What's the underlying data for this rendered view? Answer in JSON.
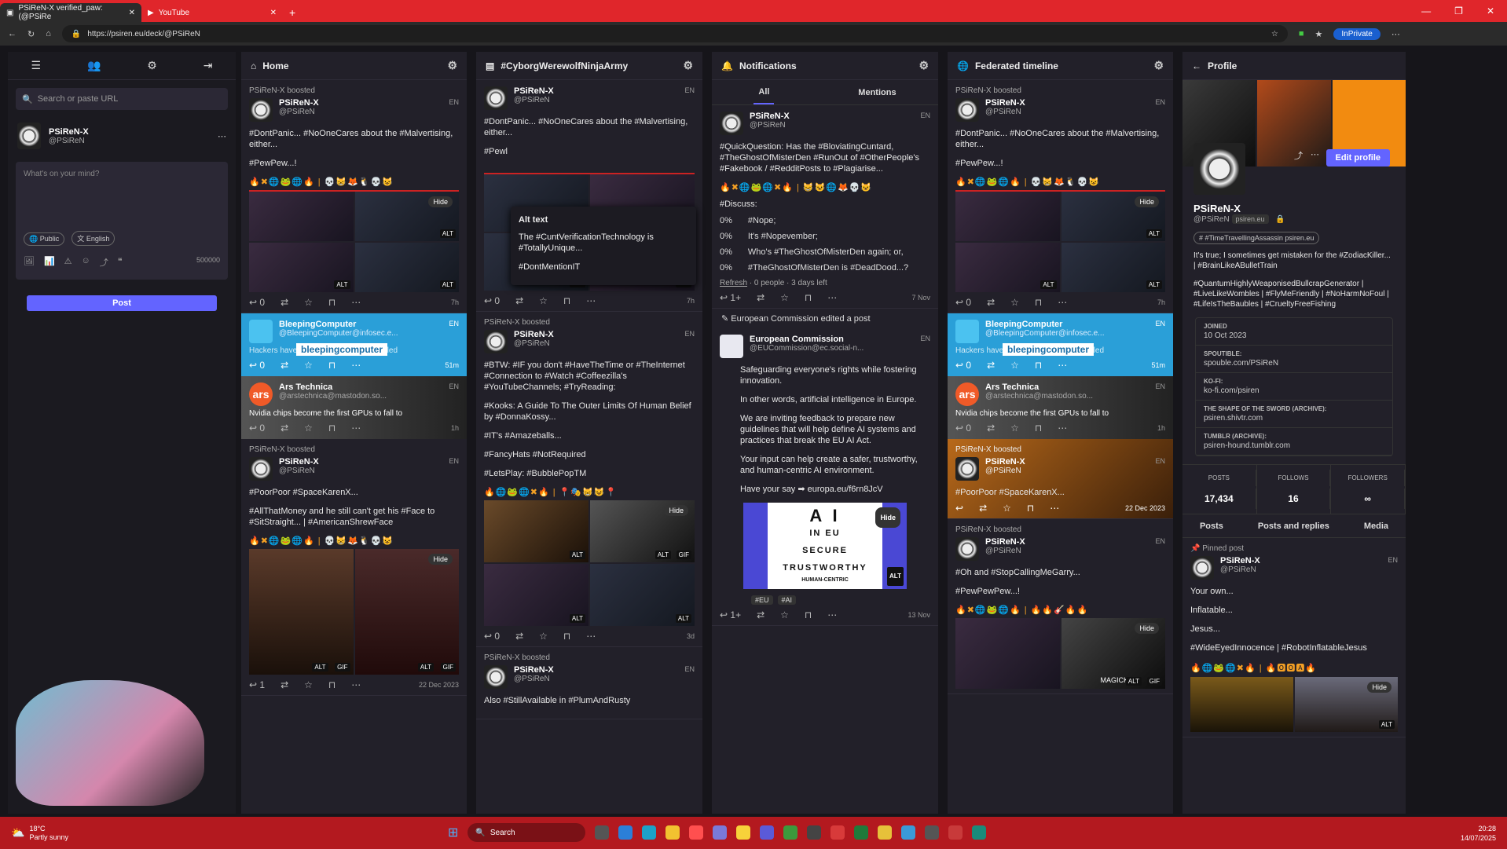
{
  "browser": {
    "tab1": "PSiReN-X verified_paw: (@PSiRe",
    "tab2": "YouTube",
    "url": "https://psiren.eu/deck/@PSiReN",
    "inprivate": "InPrivate"
  },
  "sidebar": {
    "search_placeholder": "Search or paste URL",
    "user_name": "PSiReN-X",
    "user_handle": "@PSiReN",
    "compose_placeholder": "What's on your mind?",
    "visibility": "Public",
    "language": "English",
    "char_count": "500000",
    "post_label": "Post"
  },
  "home": {
    "title": "Home",
    "p1": {
      "boost": "PSiReN-X boosted",
      "name": "PSiReN-X",
      "handle": "@PSiReN",
      "meta": "EN",
      "line1": "#DontPanic... #NoOneCares about the #Malvertising, either...",
      "line2": "#PewPew...!",
      "emoji": "🔥✖🌐🐸🌐🔥 | 💀😸🦊🐧💀😺",
      "time": "7h",
      "hide": "Hide",
      "alt": "ALT"
    },
    "card1": {
      "name": "BleepingComputer",
      "handle": "@BleepingComputer@infosec.e...",
      "text": "Hackers have been exploiting a flaw called",
      "logo": "bleepingcomputer",
      "time": "51m",
      "meta": "EN"
    },
    "card2": {
      "name": "Ars Technica",
      "handle": "@arstechnica@mastodon.so...",
      "text": "Nvidia chips become the first GPUs to fall to",
      "time": "1h",
      "meta": "EN",
      "logo": "ars"
    },
    "p2": {
      "boost": "PSiReN-X boosted",
      "name": "PSiReN-X",
      "handle": "@PSiReN",
      "meta": "EN",
      "line1": "#PoorPoor #SpaceKarenX...",
      "line2": "#AllThatMoney and he still can't get his #Face to #SitStraight... | #AmericanShrewFace",
      "emoji": "🔥✖🌐🐸🌐🔥 | 💀😸🦊🐧💀😺",
      "hide": "Hide",
      "time": "22 Dec 2023",
      "replies": "1",
      "alt": "ALT",
      "gif": "GIF"
    }
  },
  "cyber": {
    "title": "#CyborgWerewolfNinjaArmy",
    "p1": {
      "name": "PSiReN-X",
      "handle": "@PSiReN",
      "meta": "EN",
      "line1": "#DontPanic... #NoOneCares about the #Malvertising, either...",
      "line2": "#Pewl",
      "time": "7h",
      "alt": "ALT"
    },
    "alttip": {
      "title": "Alt text",
      "line1": "The #CuntVerificationTechnology is #TotallyUnique...",
      "line2": "#DontMentionIT"
    },
    "p2": {
      "boost": "PSiReN-X boosted",
      "name": "PSiReN-X",
      "handle": "@PSiReN",
      "meta": "EN",
      "t1": "#BTW: #IF you don't #HaveTheTime or #TheInternet #Connection to #Watch #Coffeezilla's #YouTubeChannels; #TryReading:",
      "t2": "#Kooks: A Guide To The Outer Limits Of Human Belief by #DonnaKossy...",
      "t3": "#IT's #Amazeballs...",
      "t4": "#FancyHats #NotRequired",
      "t5": "#LetsPlay: #BubblePopTM",
      "emoji": "🔥🌐🐸🌐✖🔥 | 📍🎭😸😺📍",
      "hide": "Hide",
      "time": "3d",
      "alt": "ALT",
      "gif": "GIF"
    },
    "p3": {
      "boost": "PSiReN-X boosted",
      "name": "PSiReN-X",
      "handle": "@PSiReN",
      "meta": "EN",
      "t1": "Also #StillAvailable in #PlumAndRusty"
    }
  },
  "notif": {
    "title": "Notifications",
    "tab_all": "All",
    "tab_mentions": "Mentions",
    "p1": {
      "name": "PSiReN-X",
      "handle": "@PSiReN",
      "meta": "EN",
      "t1": "#QuickQuestion: Has the #BloviatingCuntard, #TheGhostOfMisterDen #RunOut of #OtherPeople's #Fakebook / #RedditPosts to #Plagiarise...",
      "emoji": "🔥✖🌐🐸🌐✖🔥 | 😸😺🌐🦊💀😺",
      "discuss": "#Discuss:",
      "o1p": "0%",
      "o1": "#Nope;",
      "o2p": "0%",
      "o2": "It's #Nopevember;",
      "o3p": "0%",
      "o3": "Who's #TheGhostOfMisterDen again; or,",
      "o4p": "0%",
      "o4": "#TheGhostOfMisterDen is #DeadDood...?",
      "refresh": "Refresh",
      "pollinfo": "· 0 people · 3 days left",
      "time": "7 Nov",
      "replies": "1+"
    },
    "edited": "European Commission edited a post",
    "p2": {
      "name": "European Commission",
      "handle": "@EUCommission@ec.social-n...",
      "meta": "EN",
      "t1": "Safeguarding everyone's rights while fostering innovation.",
      "t2": "In other words, artificial intelligence in Europe.",
      "t3": "We are inviting feedback to prepare new guidelines that will help define AI systems and practices that break the EU AI Act.",
      "t4": "Your input can help create a safer, trustworthy, and human-centric AI environment.",
      "t5": "Have your say ➡ europa.eu/f6rn8JcV",
      "img1": "A I",
      "img2": "IN EU",
      "img3": "SECURE",
      "img4": "TRUSTWORTHY",
      "img5": "HUMAN-CENTRIC",
      "hide": "Hide",
      "alt": "ALT",
      "tag1": "#EU",
      "tag2": "#AI",
      "time": "13 Nov",
      "replies": "1+"
    }
  },
  "fed": {
    "title": "Federated timeline",
    "p1": {
      "boost": "PSiReN-X boosted",
      "name": "PSiReN-X",
      "handle": "@PSiReN",
      "meta": "EN",
      "line1": "#DontPanic... #NoOneCares about the #Malvertising, either...",
      "line2": "#PewPew...!",
      "emoji": "🔥✖🌐🐸🌐🔥 | 💀😸🦊🐧💀😺",
      "time": "7h",
      "hide": "Hide",
      "alt": "ALT"
    },
    "card1": {
      "name": "BleepingComputer",
      "handle": "@BleepingComputer@infosec.e...",
      "text": "Hackers have been exploiting a flaw called",
      "logo": "bleepingcomputer",
      "time": "51m",
      "meta": "EN"
    },
    "card2": {
      "name": "Ars Technica",
      "handle": "@arstechnica@mastodon.so...",
      "text": "Nvidia chips become the first GPUs to fall to",
      "time": "1h",
      "meta": "EN",
      "logo": "ars"
    },
    "p2": {
      "boost": "PSiReN-X boosted",
      "name": "PSiReN-X",
      "handle": "@PSiReN",
      "meta": "EN",
      "line1": "#PoorPoor #SpaceKarenX...",
      "time": "22 Dec 2023"
    },
    "p3": {
      "boost": "PSiReN-X boosted",
      "name": "PSiReN-X",
      "handle": "@PSiReN",
      "meta": "EN",
      "t1": "#Oh and #StopCallingMeGarry...",
      "t2": "#PewPewPew...!",
      "emoji": "🔥✖🌐🐸🌐🔥 | 🔥🔥🎸🔥🔥",
      "hide": "Hide",
      "alt": "ALT",
      "gif": "GIF",
      "caption": "MAGICK...?"
    }
  },
  "profile": {
    "title": "Profile",
    "edit": "Edit profile",
    "name": "PSiReN-X",
    "handle": "@PSiReN",
    "domain": "psiren.eu",
    "featured_tag": "#TimeTravellingAssassin",
    "featured_domain": "psiren.eu",
    "bio1": "It's true; I sometimes get mistaken for the #ZodiacKiller... | #BrainLikeABulletTrain",
    "bio2": "#QuantumHighlyWeaponisedBullcrapGenerator | #LiveLikeWombles | #FlyMeFriendly | #NoHarmNoFoul | #LifeIsTheBaubles | #CrueltyFreeFishing",
    "joined_k": "JOINED",
    "joined_v": "10 Oct 2023",
    "f1k": "SPOUTIBLE:",
    "f1v": "spouble.com/PSiReN",
    "f2k": "KO-FI:",
    "f2v": "ko-fi.com/psiren",
    "f3k": "THE SHAPE OF THE SWORD (ARCHIVE):",
    "f3v": "psiren.shivtr.com",
    "f4k": "TUMBLR (ARCHIVE):",
    "f4v": "psiren-hound.tumblr.com",
    "posts_k": "POSTS",
    "posts_v": "17,434",
    "follows_k": "FOLLOWS",
    "follows_v": "16",
    "followers_k": "FOLLOWERS",
    "followers_v": "∞",
    "tab1": "Posts",
    "tab2": "Posts and replies",
    "tab3": "Media",
    "pinned": "Pinned post",
    "pname": "PSiReN-X",
    "phandle": "@PSiReN",
    "pmeta": "EN",
    "pl1": "Your own...",
    "pl2": "Inflatable...",
    "pl3": "Jesus...",
    "pl4": "#WideEyedInnocence | #RobotInflatableJesus",
    "emoji": "🔥🌐🐸🌐✖🔥 | 🔥🅾🅾🅰🔥",
    "hide": "Hide",
    "alt": "ALT"
  },
  "taskbar": {
    "temp": "18°C",
    "weather": "Partly sunny",
    "search": "Search",
    "time": "20:28",
    "date": "14/07/2025"
  }
}
